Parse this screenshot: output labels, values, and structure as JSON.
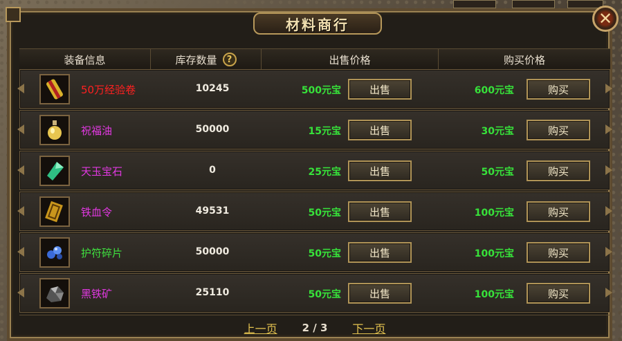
{
  "window": {
    "title": "材料商行",
    "close_symbol": "✕"
  },
  "columns": {
    "item_info": "装备信息",
    "stock_qty": "库存数量",
    "help_symbol": "?",
    "sell_price": "出售价格",
    "buy_price": "购买价格"
  },
  "rows": [
    {
      "name": "50万经验卷",
      "name_color": "#ff2020",
      "icon": "scroll-icon",
      "stock": "10245",
      "sell_price": "500元宝",
      "buy_price": "600元宝",
      "sell_label": "出售",
      "buy_label": "购买"
    },
    {
      "name": "祝福油",
      "name_color": "#e038e0",
      "icon": "oil-bottle-icon",
      "stock": "50000",
      "sell_price": "15元宝",
      "buy_price": "30元宝",
      "sell_label": "出售",
      "buy_label": "购买"
    },
    {
      "name": "天玉宝石",
      "name_color": "#e038e0",
      "icon": "jade-gem-icon",
      "stock": "0",
      "sell_price": "25元宝",
      "buy_price": "50元宝",
      "sell_label": "出售",
      "buy_label": "购买"
    },
    {
      "name": "铁血令",
      "name_color": "#e038e0",
      "icon": "token-icon",
      "stock": "49531",
      "sell_price": "50元宝",
      "buy_price": "100元宝",
      "sell_label": "出售",
      "buy_label": "购买"
    },
    {
      "name": "护符碎片",
      "name_color": "#3fe03f",
      "icon": "amulet-shard-icon",
      "stock": "50000",
      "sell_price": "50元宝",
      "buy_price": "100元宝",
      "sell_label": "出售",
      "buy_label": "购买"
    },
    {
      "name": "黑铁矿",
      "name_color": "#e038e0",
      "icon": "iron-ore-icon",
      "stock": "25110",
      "sell_price": "50元宝",
      "buy_price": "100元宝",
      "sell_label": "出售",
      "buy_label": "购买"
    }
  ],
  "pager": {
    "prev": "上一页",
    "current": "2 / 3",
    "next": "下一页"
  }
}
